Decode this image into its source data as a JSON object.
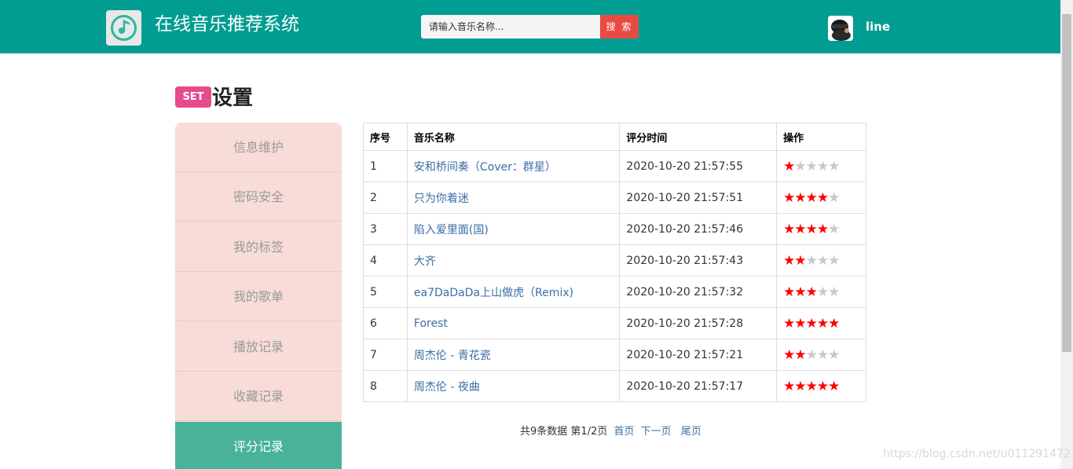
{
  "header": {
    "title": "在线音乐推荐系统",
    "search_placeholder": "请输入音乐名称...",
    "search_button": "搜 索",
    "username": "line"
  },
  "page": {
    "badge": "SET",
    "title": "设置"
  },
  "sidebar": {
    "items": [
      {
        "label": "信息维护"
      },
      {
        "label": "密码安全"
      },
      {
        "label": "我的标签"
      },
      {
        "label": "我的歌单"
      },
      {
        "label": "播放记录"
      },
      {
        "label": "收藏记录"
      },
      {
        "label": "评分记录",
        "active": true
      }
    ]
  },
  "table": {
    "headers": [
      "序号",
      "音乐名称",
      "评分时间",
      "操作"
    ],
    "rows": [
      {
        "index": "1",
        "song": "安和桥间奏（Cover：群星）",
        "time": "2020-10-20 21:57:55",
        "rating": 1
      },
      {
        "index": "2",
        "song": "只为你着迷",
        "time": "2020-10-20 21:57:51",
        "rating": 4
      },
      {
        "index": "3",
        "song": "陷入爱里面(国)",
        "time": "2020-10-20 21:57:46",
        "rating": 4
      },
      {
        "index": "4",
        "song": "大齐",
        "time": "2020-10-20 21:57:43",
        "rating": 2
      },
      {
        "index": "5",
        "song": "ea7DaDaDa上山做虎（Remix)",
        "time": "2020-10-20 21:57:32",
        "rating": 3
      },
      {
        "index": "6",
        "song": "Forest",
        "time": "2020-10-20 21:57:28",
        "rating": 5
      },
      {
        "index": "7",
        "song": "周杰伦 - 青花瓷",
        "time": "2020-10-20 21:57:21",
        "rating": 2
      },
      {
        "index": "8",
        "song": "周杰伦 - 夜曲",
        "time": "2020-10-20 21:57:17",
        "rating": 5
      }
    ]
  },
  "pagination": {
    "summary": "共9条数据",
    "page": "第1/2页",
    "first": "首页",
    "next": "下一页",
    "last": "尾页"
  },
  "watermark": "https://blog.csdn.net/u011291472",
  "colors": {
    "header_bg": "#019d92",
    "search_button": "#e84b43",
    "badge": "#e84b8c",
    "sidebar_bg": "#f7dcd7",
    "sidebar_active": "#48b29b",
    "star_on": "#ff0000",
    "star_off": "#c8c8c8",
    "link": "#3a6ea5"
  }
}
